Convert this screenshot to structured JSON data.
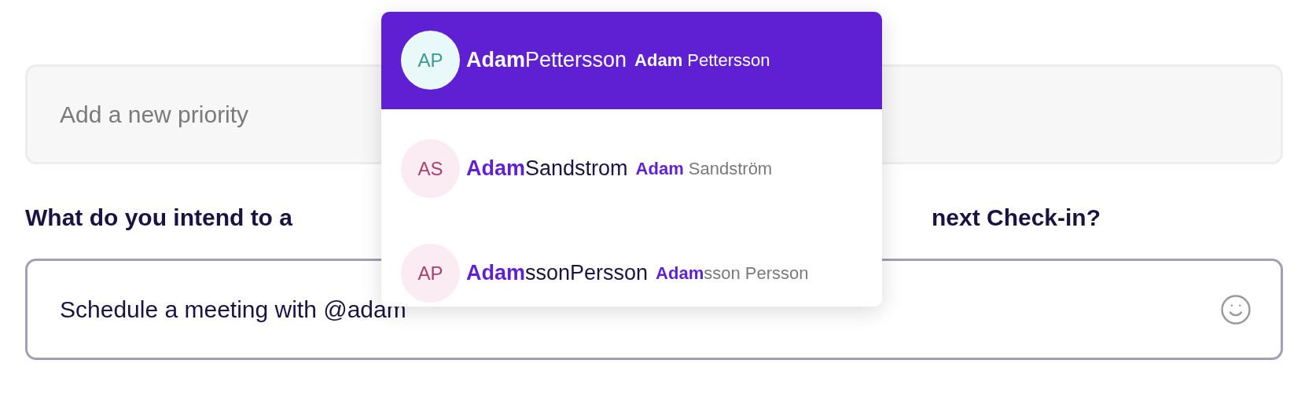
{
  "priority_field": {
    "placeholder": "Add a new priority"
  },
  "question": {
    "visible_start": "What do you intend to a",
    "visible_end": "next Check-in?"
  },
  "message_field": {
    "value": "Schedule a meeting with @adam"
  },
  "mention_menu": {
    "items": [
      {
        "initials": "AP",
        "handle": "**Adam**Pettersson",
        "full_name": "**Adam** Pettersson",
        "selected": true,
        "color": "#3a9a90"
      },
      {
        "initials": "AS",
        "handle": "**Adam**Sandstrom",
        "full_name": "**Adam** Sandström",
        "selected": false,
        "color": "#a8406a"
      },
      {
        "initials": "AP",
        "handle": "**Adam**ssonPersson",
        "full_name": "**Adam**sson Persson",
        "selected": false,
        "color": "#a8406a"
      }
    ]
  }
}
